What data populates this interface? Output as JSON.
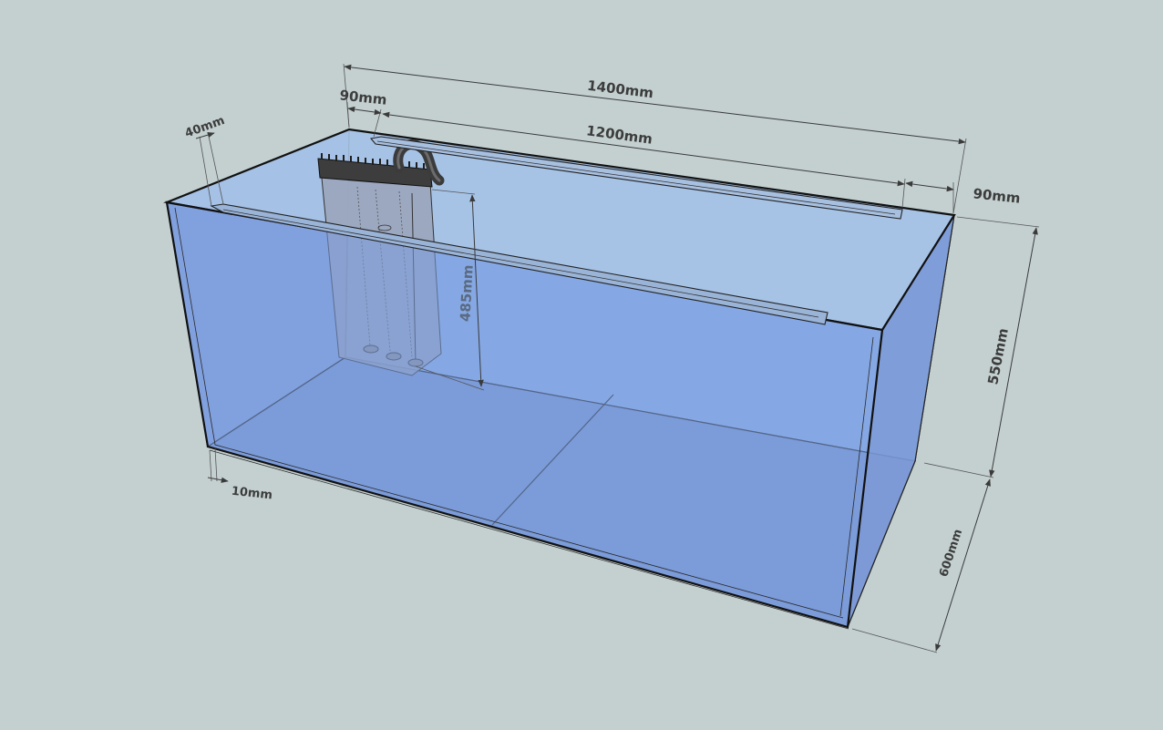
{
  "colors": {
    "background": "#c4d0d0",
    "glass_front": "#7d9fdf",
    "glass_bottom": "#7897d2",
    "glass_back": "#8fb3ec",
    "glass_top": "#a9c4e6",
    "edge": "#111111",
    "overflow_box": "#9aa3b8",
    "comb": "#3d3d3d",
    "dimension_text": "#3c3c3c"
  },
  "dimensions": {
    "overall_length": "1400mm",
    "inner_length": "1200mm",
    "left_offset": "90mm",
    "right_offset": "90mm",
    "glass_top_brace": "40mm",
    "glass_thickness": "10mm",
    "height": "550mm",
    "depth": "600mm",
    "overflow_height": "485mm"
  }
}
